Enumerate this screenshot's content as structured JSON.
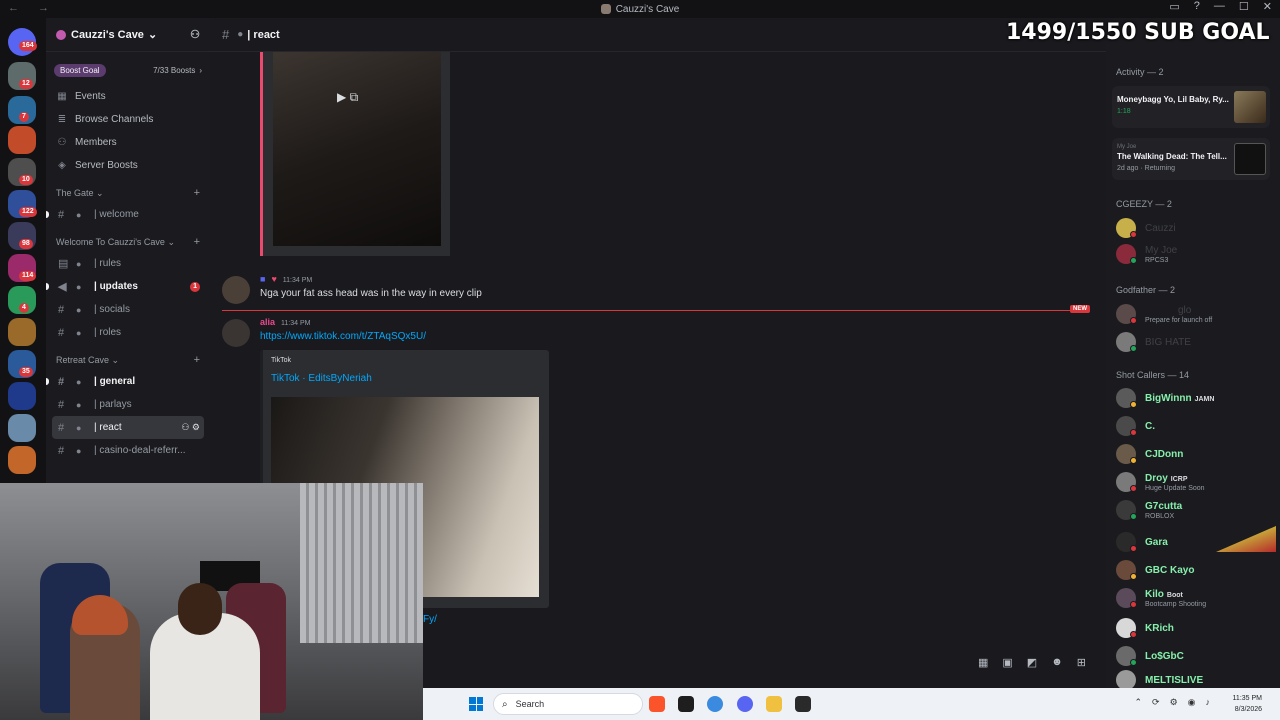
{
  "window": {
    "title": "Cauzzi's Cave"
  },
  "guild": {
    "name": "Cauzzi's Cave",
    "boost_label": "Boost Goal",
    "boost_count": "7/33 Boosts",
    "nav": [
      "Events",
      "Browse Channels",
      "Members",
      "Server Boosts"
    ],
    "categories": [
      {
        "name": "The Gate",
        "channels": [
          "| welcome"
        ]
      },
      {
        "name": "Welcome To Cauzzi's Cave",
        "channels": [
          "| rules",
          "| updates",
          "| socials",
          "| roles"
        ]
      },
      {
        "name": "Retreat Cave",
        "channels": [
          "| general",
          "| parlays",
          "| react",
          "| casino-deal-referr..."
        ]
      }
    ],
    "updates_mentions": "1"
  },
  "server_badges": [
    "164",
    "12",
    "7",
    "10",
    "122",
    "98",
    "114",
    "4",
    "35"
  ],
  "chat": {
    "channel": "| react",
    "messages": [
      {
        "time": "11:34 PM",
        "body": "Nga your fat ass head was in the way in every clip"
      },
      {
        "name": "alia",
        "time": "11:34 PM",
        "link": "https://www.tiktok.com/t/ZTAqSQx5U/"
      }
    ],
    "new_label": "NEW",
    "embed": {
      "provider": "TikTok",
      "title": "TikTok · EditsByNeriah"
    },
    "trailing_link": "Fy/"
  },
  "stream_overlay": {
    "goal": "1499/1550 SUB GOAL"
  },
  "members": {
    "activity_header": "Activity — 2",
    "activities": [
      {
        "title": "Moneybagg Yo, Lil Baby, Ry...",
        "detail": "1:18"
      },
      {
        "label": "My Joe",
        "title": "The Walking Dead: The Tell...",
        "detail": "2d ago",
        "status": "Returning"
      }
    ],
    "groups": [
      {
        "name": "CGEEZY — 2",
        "members": [
          {
            "name": "Cauzzi",
            "dim": true
          },
          {
            "name": "My Joe",
            "dim": true,
            "sub": "RPCS3"
          }
        ]
      },
      {
        "name": "Godfather — 2",
        "members": [
          {
            "name": "",
            "tag": "glo",
            "sub": "Prepare for launch off"
          },
          {
            "name": "BIG HATE",
            "dim": true
          }
        ]
      },
      {
        "name": "Shot Callers — 14",
        "members": [
          {
            "name": "BigWinnn",
            "tag": "JAMN"
          },
          {
            "name": "C."
          },
          {
            "name": "CJDonn"
          },
          {
            "name": "Droy",
            "tag": "ICRP",
            "sub": "Huge Update Soon"
          },
          {
            "name": "G7cutta",
            "sub": "ROBLOX"
          },
          {
            "name": "Gara"
          },
          {
            "name": "GBC Kayo"
          },
          {
            "name": "Kilo",
            "tag": "Boot",
            "sub": "Bootcamp Shooting"
          },
          {
            "name": "KRich"
          },
          {
            "name": "Lo$GbC"
          },
          {
            "name": "MELTISLIVE"
          }
        ]
      }
    ]
  },
  "taskbar": {
    "search": "Search",
    "time": "11:35 PM",
    "date": "8/3/2026"
  },
  "colors": {
    "accent": "#5865f2",
    "online": "#23a55a",
    "mention": "#da373c",
    "link": "#00a8fc",
    "member_name": "#86efac"
  }
}
